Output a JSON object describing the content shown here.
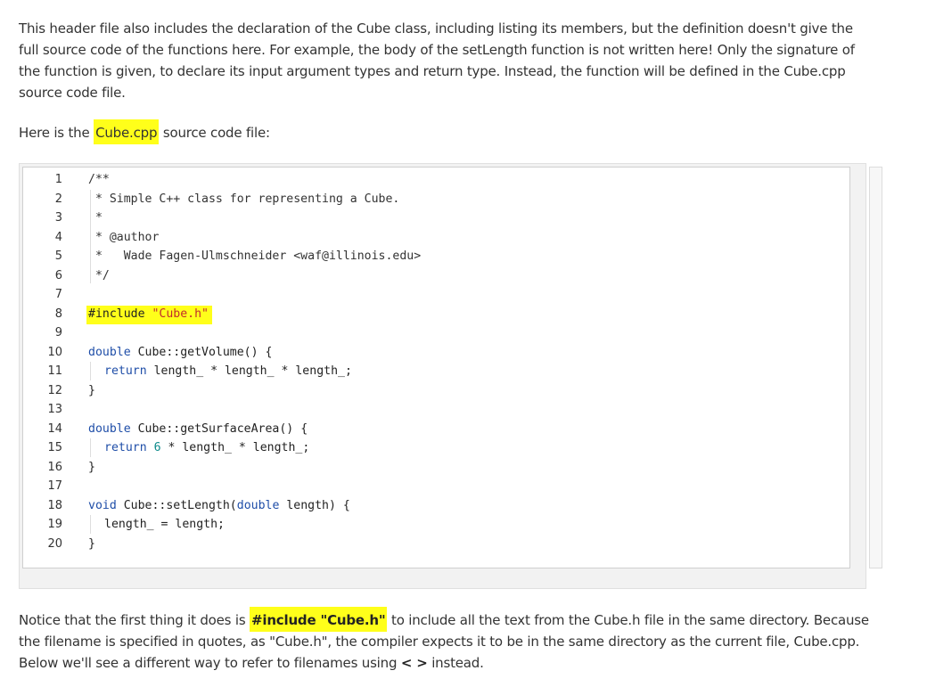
{
  "intro": {
    "paragraph": "This header file also includes the declaration of the Cube class, including listing its members, but the definition doesn't give the full source code of the functions here. For example, the body of the setLength function is not written here! Only the signature of the function is given, to declare its input argument types and return type. Instead, the function will be defined in the Cube.cpp source code file."
  },
  "source_intro": {
    "prefix": "Here is the ",
    "highlight": "Cube.cpp",
    "suffix": " source code file:"
  },
  "code": {
    "line_numbers": [
      "1",
      "2",
      "3",
      "4",
      "5",
      "6",
      "7",
      "8",
      "9",
      "10",
      "11",
      "12",
      "13",
      "14",
      "15",
      "16",
      "17",
      "18",
      "19",
      "20"
    ],
    "l1": "/**",
    "l2": " * Simple C++ class for representing a Cube.",
    "l3": " *",
    "l4": " * @author",
    "l5": " *   Wade Fagen-Ulmschneider <waf@illinois.edu>",
    "l6": " */",
    "l8_directive": "#include",
    "l8_string": "\"Cube.h\"",
    "l10_type": "double",
    "l10_rest": " Cube::getVolume() {",
    "l11_kw": "return",
    "l11_rest": " length_ * length_ * length_;",
    "l12": "}",
    "l14_type": "double",
    "l14_rest": " Cube::getSurfaceArea() {",
    "l15_kw": "return",
    "l15_num": "6",
    "l15_rest": " * length_ * length_;",
    "l16": "}",
    "l18_type": "void",
    "l18_mid": " Cube::setLength(",
    "l18_type2": "double",
    "l18_rest": " length) {",
    "l19": "length_ = length;",
    "l20": "}"
  },
  "notice": {
    "prefix": "Notice that the first thing it does is ",
    "code": "#include \"Cube.h\"",
    "middle": " to include all the text from the Cube.h file in the same directory. Because the filename is specified in quotes, as \"Cube.h\", the compiler expects it to be in the same directory as the current file, Cube.cpp. Below we'll see a different way to refer to filenames using ",
    "brackets": "< >",
    "suffix": " instead."
  }
}
